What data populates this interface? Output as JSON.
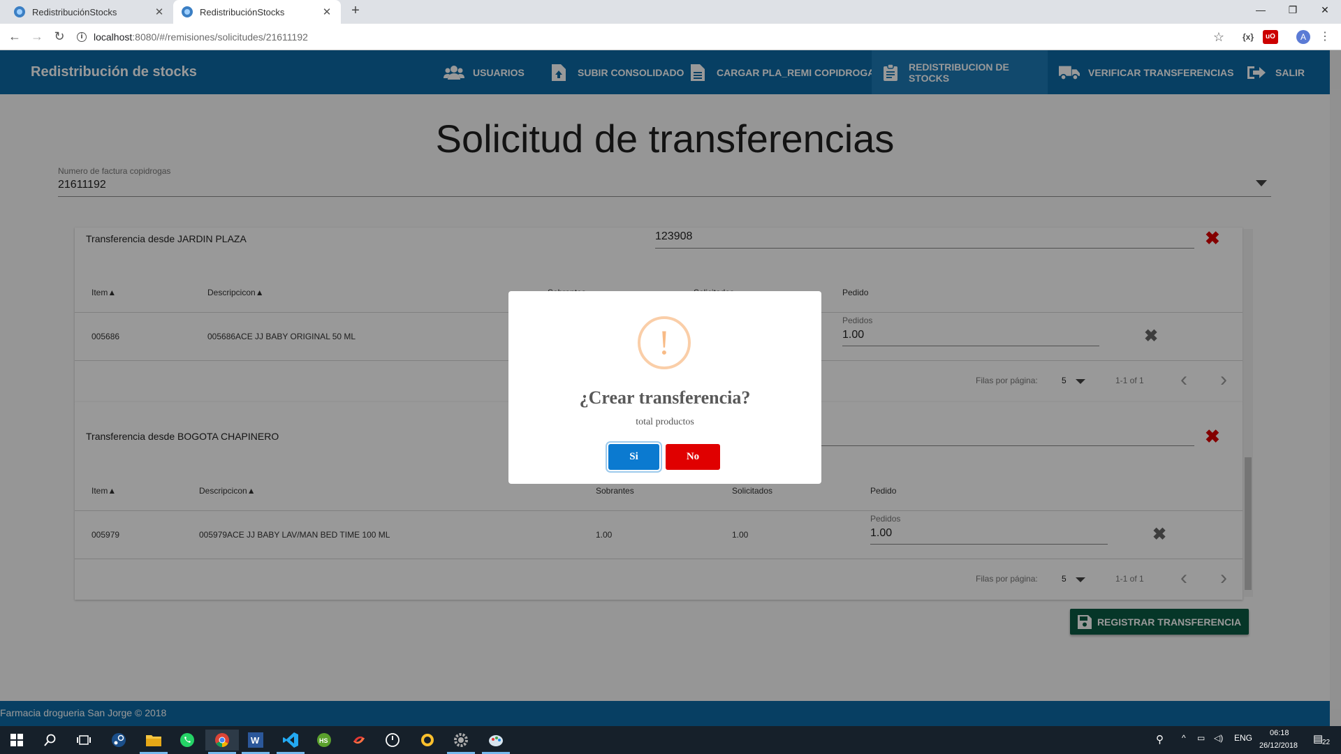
{
  "browser": {
    "tabs": [
      {
        "title": "RedistribuciónStocks",
        "active": false
      },
      {
        "title": "RedistribuciónStocks",
        "active": true
      }
    ],
    "new_tab": "+",
    "url_host": "localhost",
    "url_path": ":8080/#/remisiones/solicitudes/21611192",
    "profile_initial": "A"
  },
  "app": {
    "brand": "Redistribución de stocks",
    "nav": [
      {
        "label": "USUARIOS",
        "icon": "users-icon"
      },
      {
        "label": "SUBIR CONSOLIDADO",
        "icon": "upload-file-icon"
      },
      {
        "label": "CARGAR PLA_REMI COPIDROGAS",
        "icon": "document-icon"
      },
      {
        "label": "REDISTRIBUCION DE STOCKS",
        "icon": "clipboard-icon",
        "active": true
      },
      {
        "label": "VERIFICAR TRANSFERENCIAS",
        "icon": "truck-icon"
      },
      {
        "label": "SALIR",
        "icon": "logout-icon"
      }
    ],
    "page_title": "Solicitud de transferencias",
    "invoice_select": {
      "label": "Numero de factura copidrogas",
      "value": "21611192"
    },
    "transfers": [
      {
        "title": "Transferencia desde JARDIN PLAZA",
        "field_value": "123908",
        "columns": {
          "item": "Item",
          "desc": "Descripcicon",
          "sobrantes": "Sobrantes",
          "solicitados": "Solicitados",
          "pedido": "Pedido"
        },
        "rows": [
          {
            "item": "005686",
            "desc": "005686ACE JJ BABY ORIGINAL 50 ML",
            "sobrantes": "",
            "solicitados": "",
            "pedido_label": "Pedidos",
            "pedido": "1.00"
          }
        ],
        "pagination": {
          "label": "Filas por página:",
          "per_page": "5",
          "range": "1-1 of 1"
        }
      },
      {
        "title": "Transferencia desde BOGOTA CHAPINERO",
        "field_value": "",
        "columns": {
          "item": "Item",
          "desc": "Descripcicon",
          "sobrantes": "Sobrantes",
          "solicitados": "Solicitados",
          "pedido": "Pedido"
        },
        "rows": [
          {
            "item": "005979",
            "desc": "005979ACE JJ BABY LAV/MAN BED TIME 100 ML",
            "sobrantes": "1.00",
            "solicitados": "1.00",
            "pedido_label": "Pedidos",
            "pedido": "1.00"
          }
        ],
        "pagination": {
          "label": "Filas por página:",
          "per_page": "5",
          "range": "1-1 of 1"
        }
      }
    ],
    "register_button": "REGISTRAR TRANSFERENCIA",
    "footer": "Farmacia drogueria San Jorge © 2018"
  },
  "dialog": {
    "icon": "!",
    "title": "¿Crear transferencia?",
    "text": "total productos",
    "confirm": "Si",
    "cancel": "No"
  },
  "taskbar": {
    "language": "ENG",
    "time": "06:18",
    "date": "26/12/2018",
    "notifications": "22"
  },
  "colors": {
    "appbar": "#0d6aa5",
    "register_button": "#0b5b43",
    "confirm": "#0b7ad0",
    "cancel": "#e00000",
    "delete": "#dd0000"
  }
}
